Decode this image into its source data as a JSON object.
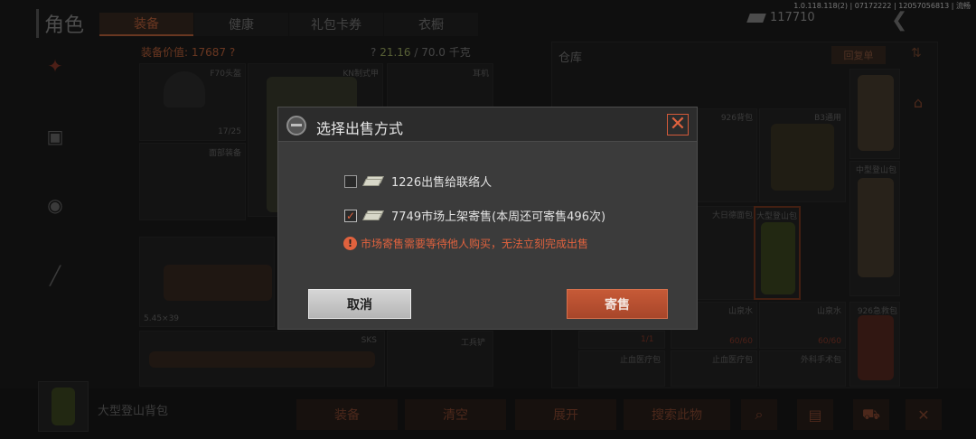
{
  "version": "1.0.118.118(2) | 07172222 | 12057056813 | 流畅",
  "role_title": "角色",
  "tabs": [
    {
      "label": "装备",
      "active": true
    },
    {
      "label": "健康",
      "active": false
    },
    {
      "label": "礼包卡券",
      "active": false
    },
    {
      "label": "衣橱",
      "active": false
    }
  ],
  "money": "117710",
  "equipment": {
    "value_label": "装备价值: 17687 ?",
    "weight_prefix": "? ",
    "weight_current": "21.16",
    "weight_rest": " / 70.0 千克",
    "slots": {
      "helmet": "F70头盔",
      "helmet_durability": "17/25",
      "armor": "KN制式甲",
      "earphone": "耳机",
      "face": "面部装备",
      "ammo": "5.45×39",
      "sks": "SKS",
      "shovel": "工兵铲"
    }
  },
  "warehouse": {
    "title": "仓库",
    "button": "回复单",
    "cells": {
      "bag926": "926背包",
      "b3": "B3通用",
      "medium_bag": "中型登山包",
      "tactical_bag": "大日德面包",
      "large_bag": "大型登山包",
      "water1": "山泉水",
      "water2": "山泉水",
      "emergency": "926急救包",
      "count_a": "1/1",
      "count_b": "60/60",
      "count_c": "60/60",
      "med1": "止血医疗包",
      "med2": "止血医疗包",
      "surgery": "外科手术包"
    }
  },
  "bottom": {
    "item_name": "大型登山背包",
    "buttons": [
      "装备",
      "清空",
      "展开",
      "搜索此物"
    ]
  },
  "dialog": {
    "title": "选择出售方式",
    "close_symbol": "✕",
    "option1": {
      "text": "1226出售给联络人",
      "checked": false
    },
    "option2": {
      "text": "7749市场上架寄售(本周还可寄售496次)",
      "checked": true
    },
    "check_mark": "✓",
    "warning_symbol": "!",
    "warning": "市场寄售需要等待他人购买，无法立刻完成出售",
    "cancel_label": "取消",
    "confirm_label": "寄售"
  },
  "colors": {
    "accent": "#e0623e",
    "dialog_bg": "#3b3b3b",
    "cancel_bg": "#c8c8c8",
    "confirm_bg": "#b54f30"
  }
}
